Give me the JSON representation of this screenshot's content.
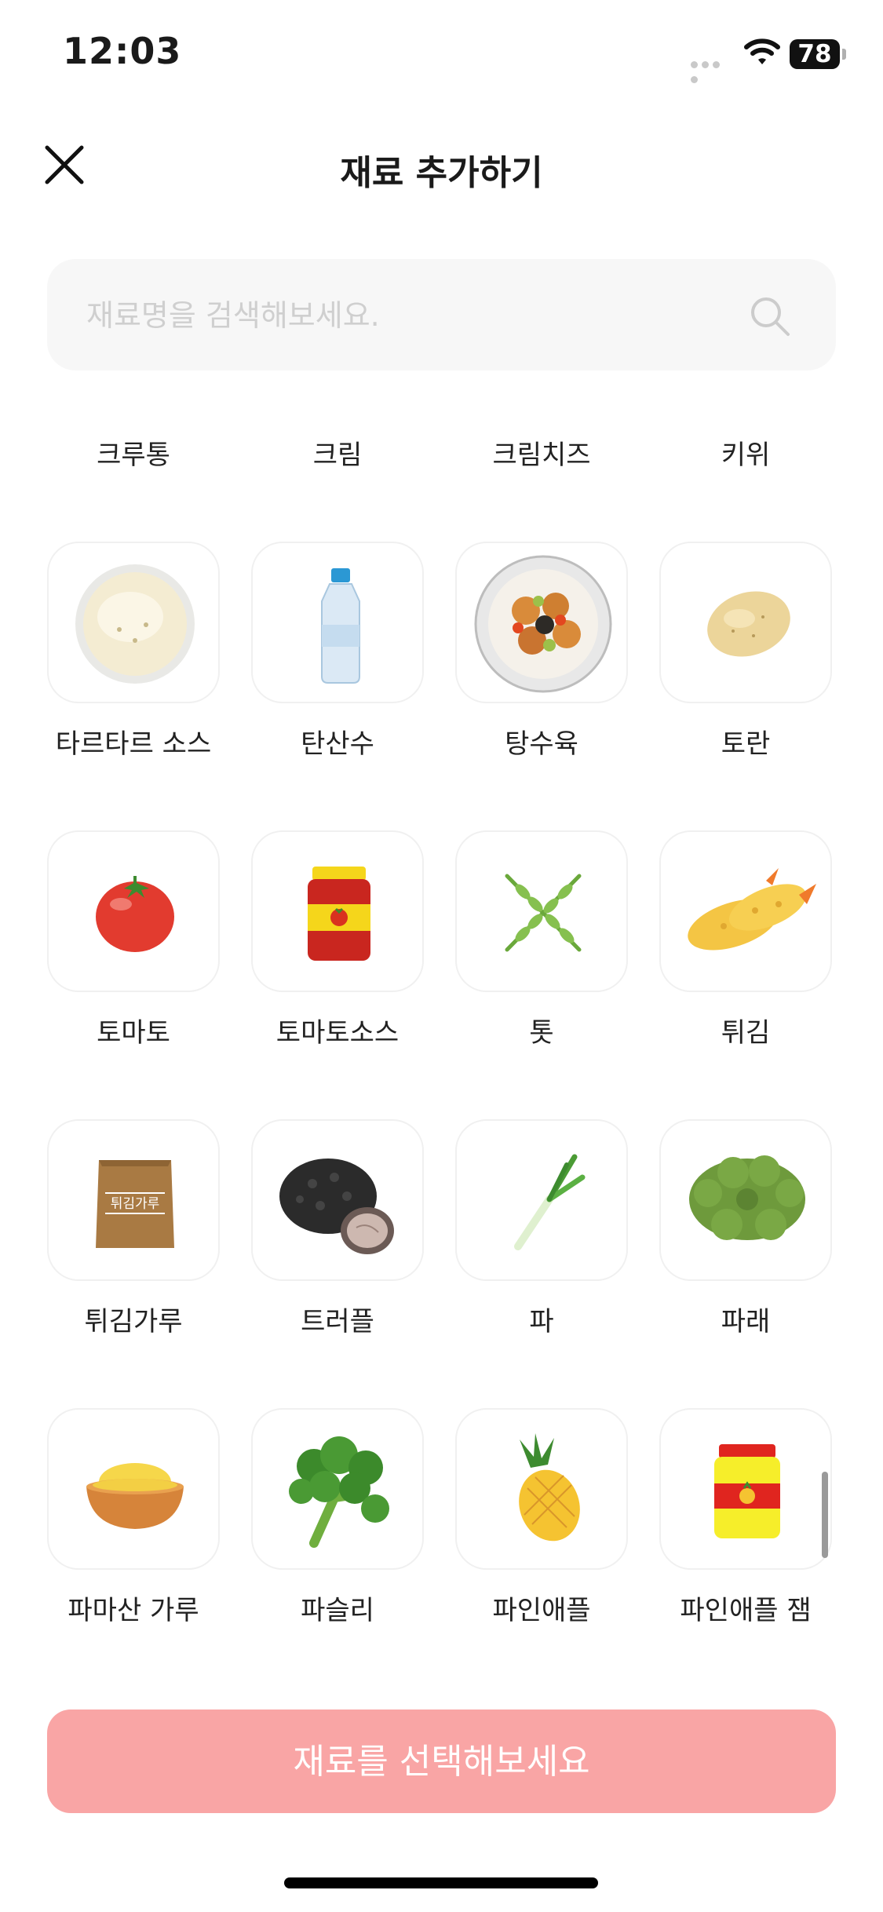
{
  "status_bar": {
    "time": "12:03",
    "battery": "78"
  },
  "header": {
    "title": "재료 추가하기"
  },
  "search": {
    "placeholder": "재료명을 검색해보세요."
  },
  "top_row": [
    "크루통",
    "크림",
    "크림치즈",
    "키위"
  ],
  "ingredients": [
    {
      "label": "타르타르 소스",
      "icon": "tartar-sauce-icon"
    },
    {
      "label": "탄산수",
      "icon": "water-bottle-icon"
    },
    {
      "label": "탕수육",
      "icon": "sweet-sour-pork-icon"
    },
    {
      "label": "토란",
      "icon": "taro-icon"
    },
    {
      "label": "토마토",
      "icon": "tomato-icon"
    },
    {
      "label": "토마토소스",
      "icon": "tomato-sauce-jar-icon"
    },
    {
      "label": "톳",
      "icon": "seaweed-sprig-icon"
    },
    {
      "label": "튀김",
      "icon": "fried-shrimp-icon"
    },
    {
      "label": "튀김가루",
      "icon": "flour-bag-icon",
      "badge": "튀김가루"
    },
    {
      "label": "트러플",
      "icon": "truffle-icon"
    },
    {
      "label": "파",
      "icon": "green-onion-icon"
    },
    {
      "label": "파래",
      "icon": "green-laver-icon"
    },
    {
      "label": "파마산 가루",
      "icon": "parmesan-bowl-icon"
    },
    {
      "label": "파슬리",
      "icon": "parsley-icon"
    },
    {
      "label": "파인애플",
      "icon": "pineapple-icon"
    },
    {
      "label": "파인애플 잼",
      "icon": "pineapple-jam-jar-icon"
    }
  ],
  "footer": {
    "cta_label": "재료를 선택해보세요"
  },
  "colors": {
    "cta": "#f9a5a5",
    "tile_border": "#f0f0f0",
    "search_bg": "#f7f7f7"
  }
}
